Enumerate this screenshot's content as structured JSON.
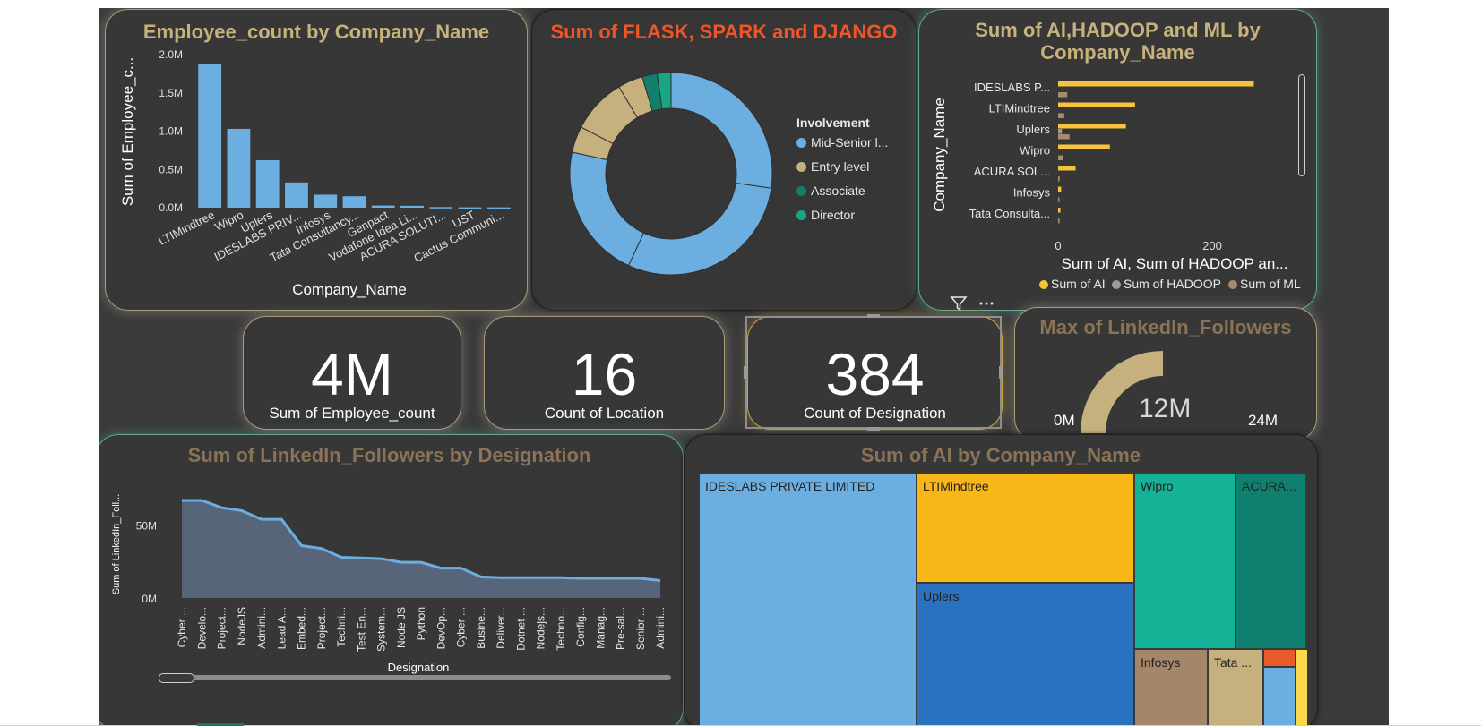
{
  "bar_chart": {
    "title": "Employee_count by Company_Name",
    "xlabel": "Company_Name",
    "ylabel": "Sum of Employee_c...",
    "bar_color": "#6caee0",
    "yticks": [
      "0.0M",
      "0.5M",
      "1.0M",
      "1.5M",
      "2.0M"
    ]
  },
  "donut_chart": {
    "title": "Sum of FLASK, SPARK and DJANGO",
    "legend_title": "Involvement",
    "legend": [
      {
        "label": "Mid-Senior l...",
        "color": "#6caee0"
      },
      {
        "label": "Entry level",
        "color": "#c5b07e"
      },
      {
        "label": "Associate",
        "color": "#127f6d"
      },
      {
        "label": "Director",
        "color": "#19a687"
      }
    ]
  },
  "hbar_chart": {
    "title": "Sum of AI,HADOOP and ML by Company_Name",
    "ylabel": "Company_Name",
    "xlabel": "Sum of AI, Sum of HADOOP an...",
    "xticks": [
      "0",
      "200"
    ],
    "legend": [
      {
        "label": "Sum of AI",
        "color": "#f7c33c"
      },
      {
        "label": "Sum of HADOOP",
        "color": "#9a9a9a"
      },
      {
        "label": "Sum of ML",
        "color": "#a68b6c"
      }
    ]
  },
  "kpis": [
    {
      "value": "4M",
      "label": "Sum of Employee_count"
    },
    {
      "value": "16",
      "label": "Count of Location"
    },
    {
      "value": "384",
      "label": "Count of Designation"
    }
  ],
  "gauge": {
    "title": "Max of LinkedIn_Followers",
    "value_label": "12M",
    "min_label": "0M",
    "max_label": "24M",
    "value": 12,
    "max": 24,
    "color": "#c5b07e"
  },
  "area_chart": {
    "title": "Sum of LinkedIn_Followers by Designation",
    "xlabel": "Designation",
    "ylabel": "Sum of LinkedIn_Foll...",
    "yticks": [
      "0M",
      "50M"
    ],
    "fill": "#56657a",
    "line": "#6caee0"
  },
  "treemap": {
    "title": "Sum of AI by Company_Name",
    "tiles": [
      {
        "label": "IDESLABS PRIVATE LIMITED",
        "color": "#6caee0"
      },
      {
        "label": "LTIMindtree",
        "color": "#f9b617"
      },
      {
        "label": "Uplers",
        "color": "#2a72c0"
      },
      {
        "label": "Wipro",
        "color": "#14b296"
      },
      {
        "label": "ACURA...",
        "color": "#10806e"
      },
      {
        "label": "Infosys",
        "color": "#a4876a"
      },
      {
        "label": "Tata ...",
        "color": "#c5b07e"
      },
      {
        "label": "",
        "color": "#e85b2a"
      },
      {
        "label": "",
        "color": "#6caee0"
      },
      {
        "label": "",
        "color": "#f9d84a"
      }
    ]
  },
  "chart_data": [
    {
      "type": "bar",
      "title": "Employee_count by Company_Name",
      "xlabel": "Company_Name",
      "ylabel": "Sum of Employee_c...",
      "categories": [
        "LTIMindtree",
        "Wipro",
        "Uplers",
        "IDESLABS PRIV...",
        "Infosys",
        "Tata Consultancy...",
        "Genpact",
        "Vodafone Idea Li...",
        "ACURA SOLUTI...",
        "UST",
        "Cactus Communi..."
      ],
      "values": [
        1880000,
        1030000,
        620000,
        330000,
        170000,
        150000,
        28000,
        25000,
        8000,
        5000,
        4000
      ],
      "ylim": [
        0,
        2000000
      ]
    },
    {
      "type": "pie",
      "title": "Sum of FLASK, SPARK and DJANGO",
      "categories": [
        "Mid-Senior l...",
        "Entry level",
        "Associate",
        "Director"
      ],
      "values": [
        81,
        14,
        3,
        2
      ],
      "hole": true,
      "slice_fractions": [
        0.273,
        0.296,
        0.215,
        0.042,
        0.088,
        0.04,
        0.024,
        0.022
      ]
    },
    {
      "type": "bar",
      "orientation": "horizontal",
      "title": "Sum of AI,HADOOP and ML by Company_Name",
      "categories": [
        "IDESLABS P...",
        "LTIMindtree",
        "Uplers",
        "Wipro",
        "ACURA SOL...",
        "Infosys",
        "Tata Consulta..."
      ],
      "series": [
        {
          "name": "Sum of AI",
          "values": [
            257,
            101,
            89,
            68,
            23,
            4,
            3
          ]
        },
        {
          "name": "Sum of HADOOP",
          "values": [
            0,
            0,
            5,
            0,
            0,
            0,
            0
          ]
        },
        {
          "name": "Sum of ML",
          "values": [
            12,
            8,
            15,
            7,
            2,
            1,
            1
          ]
        }
      ],
      "xlim": [
        0,
        300
      ]
    },
    {
      "type": "area",
      "title": "Sum of LinkedIn_Followers by Designation",
      "xlabel": "Designation",
      "ylabel": "Sum of LinkedIn_Foll...",
      "categories": [
        "Cyber ...",
        "Develo...",
        "Project...",
        "NodeJS",
        "Admini...",
        "Lead A...",
        "Embed...",
        "Project...",
        "Techni...",
        "Test En...",
        "System...",
        "Node JS",
        "Python",
        "DevOp...",
        "Cyber ...",
        "Busine...",
        "Deliver...",
        "Dotnet ...",
        "Nodejs...",
        "Techno...",
        "Config...",
        "Manag...",
        "Pre-sal...",
        "Senior ...",
        "Admini..."
      ],
      "values": [
        67,
        67,
        62,
        60,
        54,
        54,
        36,
        34,
        28,
        27.5,
        27,
        24.5,
        24.5,
        20.5,
        20.5,
        14.5,
        14,
        14,
        14,
        14,
        13.5,
        13.5,
        13.5,
        13.5,
        12
      ],
      "ylim": [
        0,
        75
      ]
    },
    {
      "type": "heatmap",
      "subtype": "treemap",
      "title": "Sum of AI by Company_Name",
      "categories": [
        "IDESLABS PRIVATE LIMITED",
        "LTIMindtree",
        "Uplers",
        "Wipro",
        "ACURA...",
        "Infosys",
        "Tata ..."
      ],
      "values": [
        257,
        101,
        89,
        68,
        23,
        4,
        3
      ]
    }
  ]
}
